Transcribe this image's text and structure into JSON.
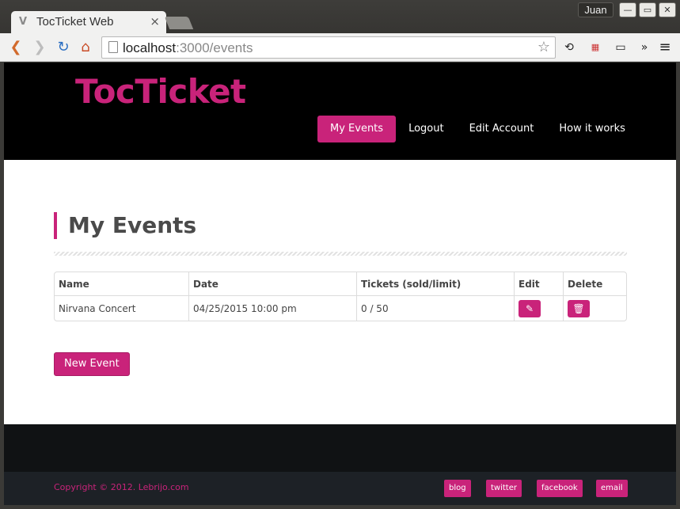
{
  "browser": {
    "tab_title": "TocTicket Web",
    "user": "Juan",
    "url_host": "localhost",
    "url_rest": ":3000/events"
  },
  "site": {
    "brand": "TocTicket",
    "nav": [
      {
        "label": "My Events",
        "active": true
      },
      {
        "label": "Logout",
        "active": false
      },
      {
        "label": "Edit Account",
        "active": false
      },
      {
        "label": "How it works",
        "active": false
      }
    ],
    "accent_color": "#c9237a"
  },
  "main": {
    "title": "My Events",
    "table": {
      "headers": [
        "Name",
        "Date",
        "Tickets (sold/limit)",
        "Edit",
        "Delete"
      ],
      "rows": [
        {
          "name": "Nirvana Concert",
          "date": "04/25/2015 10:00 pm",
          "tickets": "0 / 50",
          "edit_icon": "edit-icon",
          "delete_icon": "trash-icon"
        }
      ]
    },
    "new_event_label": "New Event"
  },
  "footer": {
    "copyright": "Copyright © 2012. Lebrijo.com",
    "links": [
      "blog",
      "twitter",
      "facebook",
      "email"
    ]
  }
}
